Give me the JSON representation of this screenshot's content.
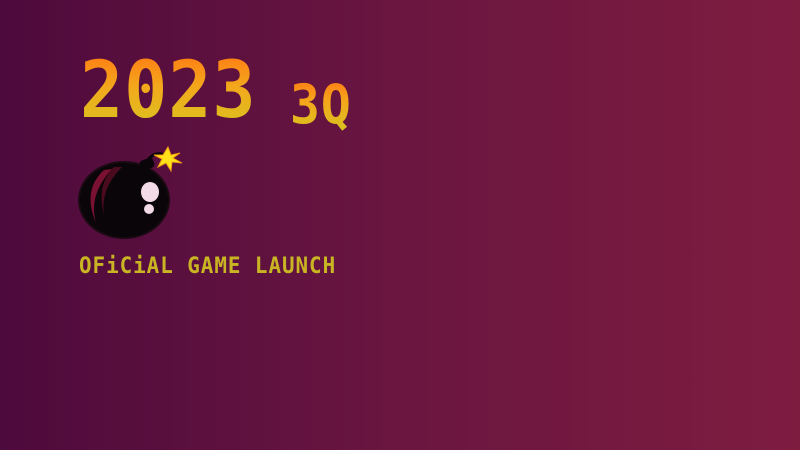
{
  "title": {
    "year": "2023",
    "quarter": "3Q"
  },
  "subtitle": "OFiCiAL GAME LAUNCH",
  "logo": {
    "icon": "bomb-icon"
  },
  "colors": {
    "bg_left": "#4d0a3c",
    "bg_right": "#7e1c40",
    "title_gradient_top": "#ff7a14",
    "title_gradient_bottom": "#d8c41f",
    "subtitle": "#c9b523",
    "bomb_body": "#0a0508",
    "bomb_accent": "#7a1032",
    "spark": "#ffe21a"
  }
}
